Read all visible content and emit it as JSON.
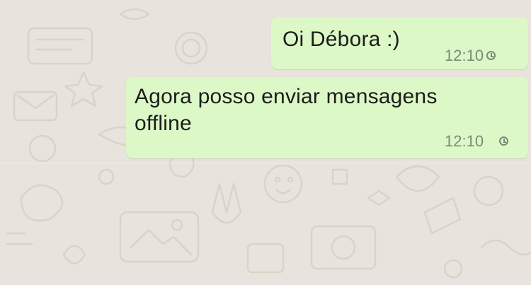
{
  "conversation": {
    "background_color": "#e8e3dc",
    "bubble_color": "#dcf8c6",
    "messages": [
      {
        "text": "Oi Débora :)",
        "time": "12:10",
        "status_icon": "clock-pending-icon"
      },
      {
        "text": "Agora posso enviar mensagens\noffline",
        "time": "12:10",
        "status_icon": "clock-pending-icon"
      }
    ]
  }
}
